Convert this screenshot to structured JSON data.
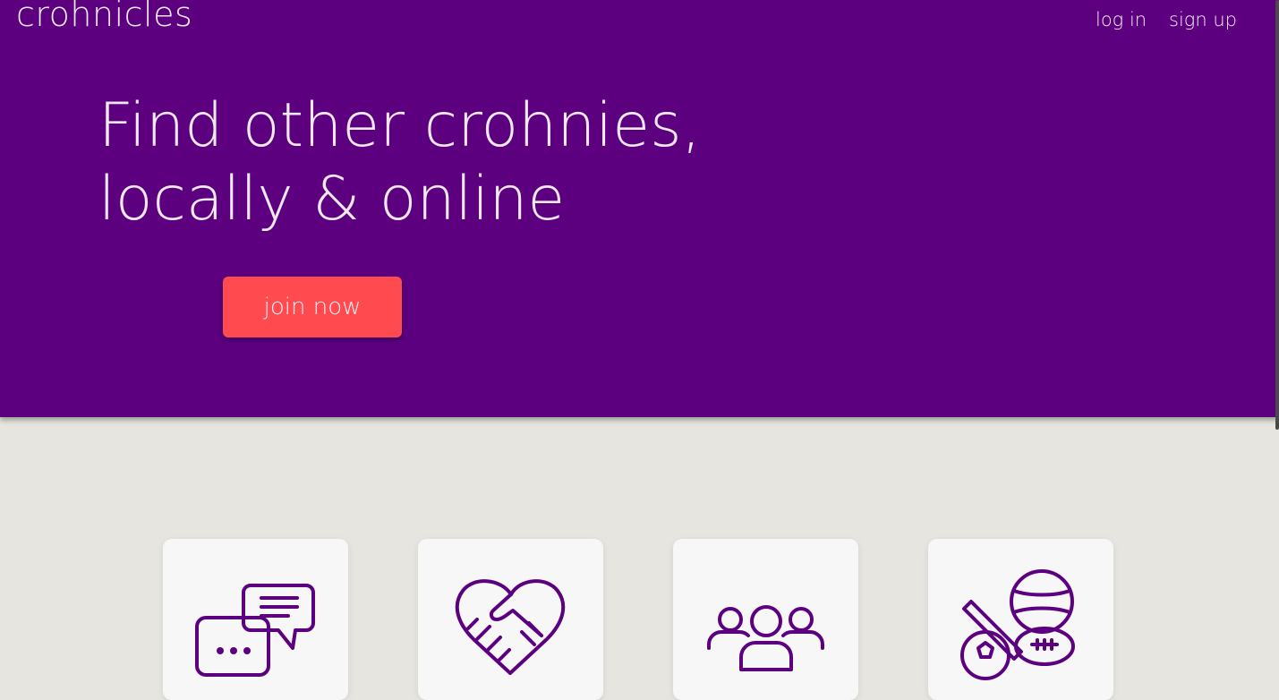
{
  "header": {
    "brand": "crohnicles",
    "nav": [
      {
        "label": "log in"
      },
      {
        "label": "sign up"
      }
    ]
  },
  "hero": {
    "headline_line1": "Find other crohnies,",
    "headline_line2": "locally & online",
    "cta_label": "join now"
  },
  "features": [
    {
      "icon": "chat-bubbles-icon"
    },
    {
      "icon": "heart-handshake-icon"
    },
    {
      "icon": "group-people-icon"
    },
    {
      "icon": "sports-balls-icon"
    }
  ],
  "colors": {
    "hero_bg": "#5c0080",
    "accent": "#ff4a4f",
    "page_bg": "#e6e5df",
    "icon_stroke": "#5c0080"
  }
}
